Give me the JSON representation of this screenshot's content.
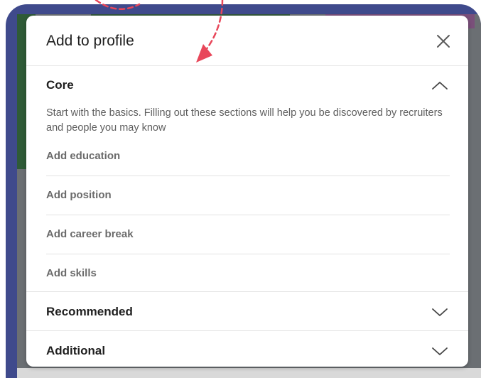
{
  "modal": {
    "title": "Add to profile",
    "close_icon": "close-icon"
  },
  "sections": {
    "core": {
      "title": "Core",
      "expanded": true,
      "toggle_icon": "chevron-up-icon",
      "description": "Start with the basics. Filling out these sections will help you be discovered by recruiters and people you may know",
      "items": [
        {
          "label": "Add education"
        },
        {
          "label": "Add position"
        },
        {
          "label": "Add career break"
        },
        {
          "label": "Add skills"
        }
      ]
    },
    "recommended": {
      "title": "Recommended",
      "expanded": false,
      "toggle_icon": "chevron-down-icon"
    },
    "additional": {
      "title": "Additional",
      "expanded": false,
      "toggle_icon": "chevron-down-icon"
    }
  },
  "annotation": {
    "arrow_color": "#e8475a",
    "frame_color": "#3f4a8c"
  }
}
